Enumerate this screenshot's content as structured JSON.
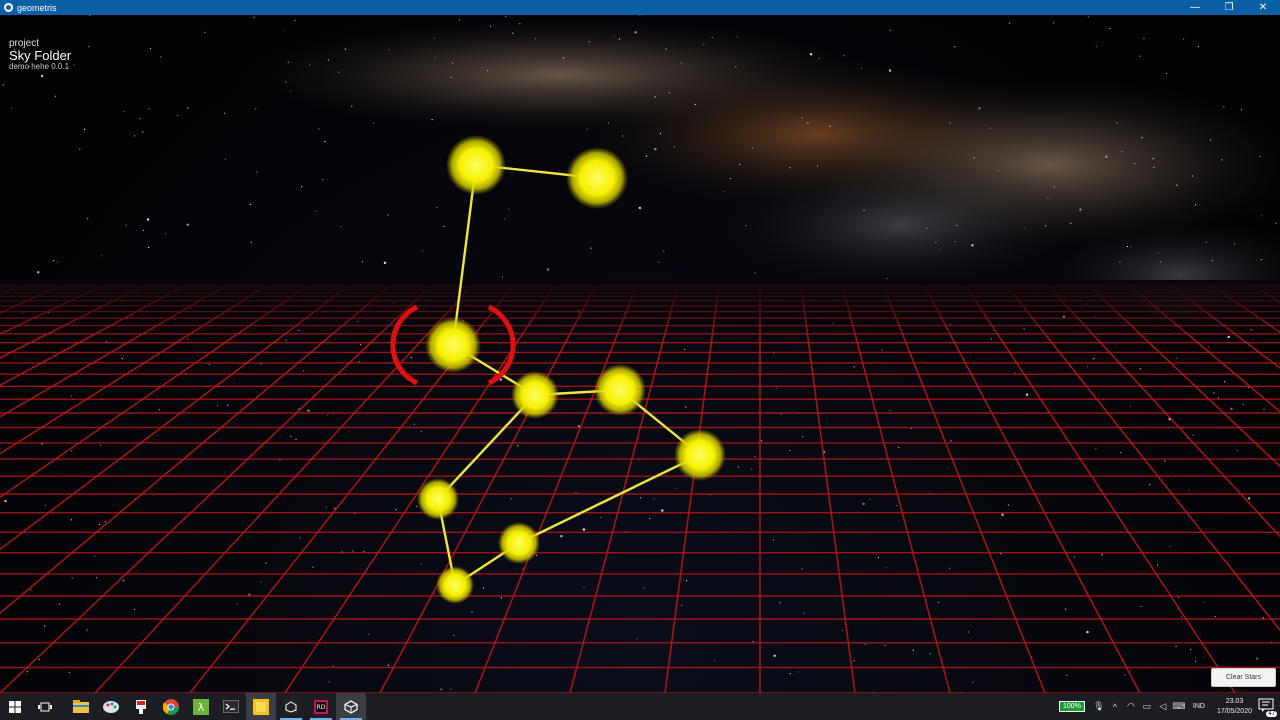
{
  "window": {
    "title": "geometris",
    "minimize_glyph": "—",
    "maximize_glyph": "❐",
    "close_glyph": "✕"
  },
  "hud": {
    "line1": "project",
    "line2": "Sky Folder",
    "line3": "demo hehe 0.0.1"
  },
  "scene": {
    "star_color": "#f5f000",
    "line_color": "#f0e63a",
    "grid_color": "#c01818",
    "selection_color": "#e01010",
    "star_count": 10,
    "selected_star_index": 2
  },
  "clear_button": {
    "label": "Clear Stars"
  },
  "taskbar": {
    "items": [
      {
        "name": "windows-start-icon",
        "active": false
      },
      {
        "name": "task-view-icon",
        "active": false
      },
      {
        "name": "file-explorer-icon",
        "active": false
      },
      {
        "name": "paint-app-icon",
        "active": false
      },
      {
        "name": "red-app-icon",
        "active": false
      },
      {
        "name": "chrome-icon",
        "active": false
      },
      {
        "name": "lambda-app-icon",
        "active": false
      },
      {
        "name": "terminal-icon",
        "active": false
      },
      {
        "name": "sticky-notes-icon",
        "active": false
      },
      {
        "name": "unity-hub-icon",
        "active": true
      },
      {
        "name": "rider-icon",
        "active": true
      },
      {
        "name": "unity-icon",
        "active": true
      }
    ],
    "battery": "100%",
    "language": "IND",
    "time": "23.03",
    "date": "17/05/2020",
    "notification_count": "47"
  }
}
